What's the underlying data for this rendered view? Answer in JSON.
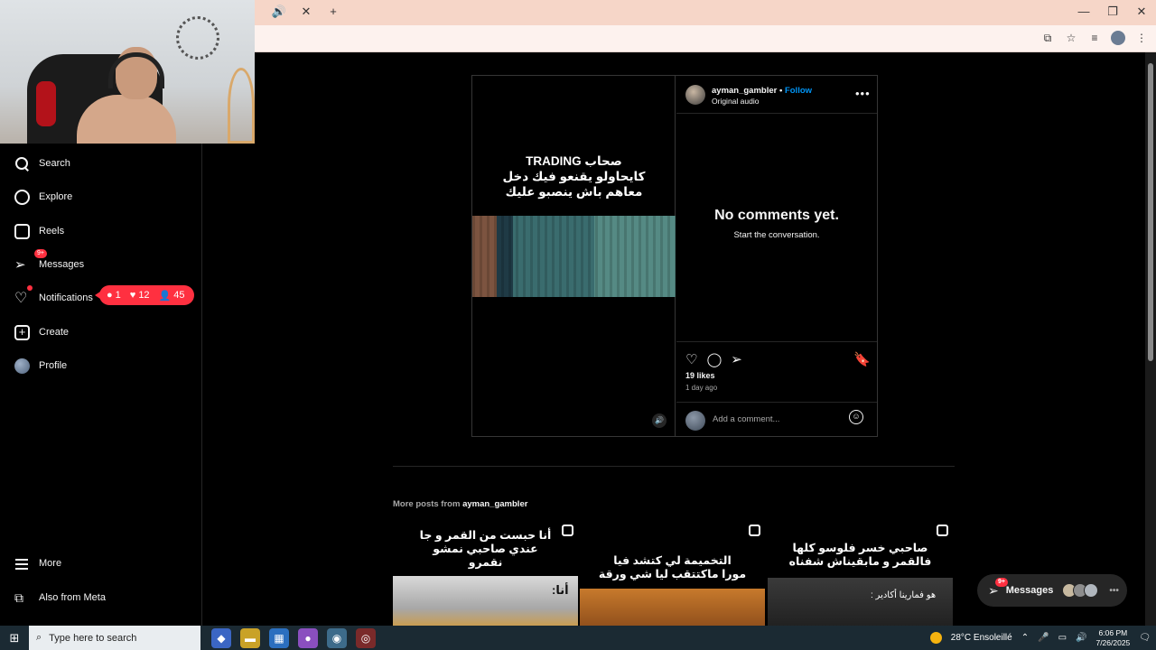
{
  "browser": {
    "tab_controls": [
      "🔊",
      "✕",
      "+"
    ],
    "window_controls": [
      "—",
      "❐",
      "✕"
    ],
    "address_icons": [
      "install-icon",
      "star-icon",
      "media-icon",
      "profile-icon",
      "menu-icon"
    ]
  },
  "sidebar": {
    "items": [
      {
        "label": "Search",
        "icon": "search-icon"
      },
      {
        "label": "Explore",
        "icon": "compass-icon"
      },
      {
        "label": "Reels",
        "icon": "reels-icon"
      },
      {
        "label": "Messages",
        "icon": "messenger-icon",
        "badge": "9+"
      },
      {
        "label": "Notifications",
        "icon": "heart-icon"
      },
      {
        "label": "Create",
        "icon": "plus-icon"
      },
      {
        "label": "Profile",
        "icon": "profile-avatar"
      },
      {
        "label": "More",
        "icon": "menu-icon"
      },
      {
        "label": "Also from Meta",
        "icon": "meta-icon"
      }
    ],
    "notification_pill": {
      "comments": "1",
      "likes": "12",
      "follows": "45"
    }
  },
  "post": {
    "media_text": [
      "صحاب TRADING",
      "كايحاولو يقنعو فيك دخل",
      "معاهم باش ينصبو عليك"
    ],
    "username": "ayman_gambler",
    "separator": "•",
    "follow_label": "Follow",
    "audio": "Original audio",
    "no_comments": "No comments yet.",
    "start_conversation": "Start the conversation.",
    "likes": "19 likes",
    "time_ago": "1 day ago",
    "comment_placeholder": "Add a comment..."
  },
  "more_posts": {
    "prefix": "More posts from",
    "username": "ayman_gambler",
    "tiles": [
      {
        "text": [
          "أنا حبست من القمر و جا",
          "عندي صاحبي نمشو",
          "نقمرو"
        ],
        "caption": "أنا:"
      },
      {
        "text": [
          "التخميمة لي كتشد فيا",
          "مورا ماكتتقب ليا شي ورقة"
        ],
        "caption": ""
      },
      {
        "text": [
          "صاحبي خسر فلوسو كلها",
          "فالقمر و مابقيناش شفناه"
        ],
        "caption": "هو فمارينا أكادير :"
      }
    ]
  },
  "floating_messages": {
    "label": "Messages",
    "badge": "9+"
  },
  "taskbar": {
    "search_placeholder": "Type here to search",
    "weather": "28°C  Ensoleillé",
    "time": "6:06 PM",
    "date": "7/26/2025"
  },
  "colors": {
    "accent": "#0095f6",
    "badge": "#ff3040",
    "background": "#000000"
  }
}
